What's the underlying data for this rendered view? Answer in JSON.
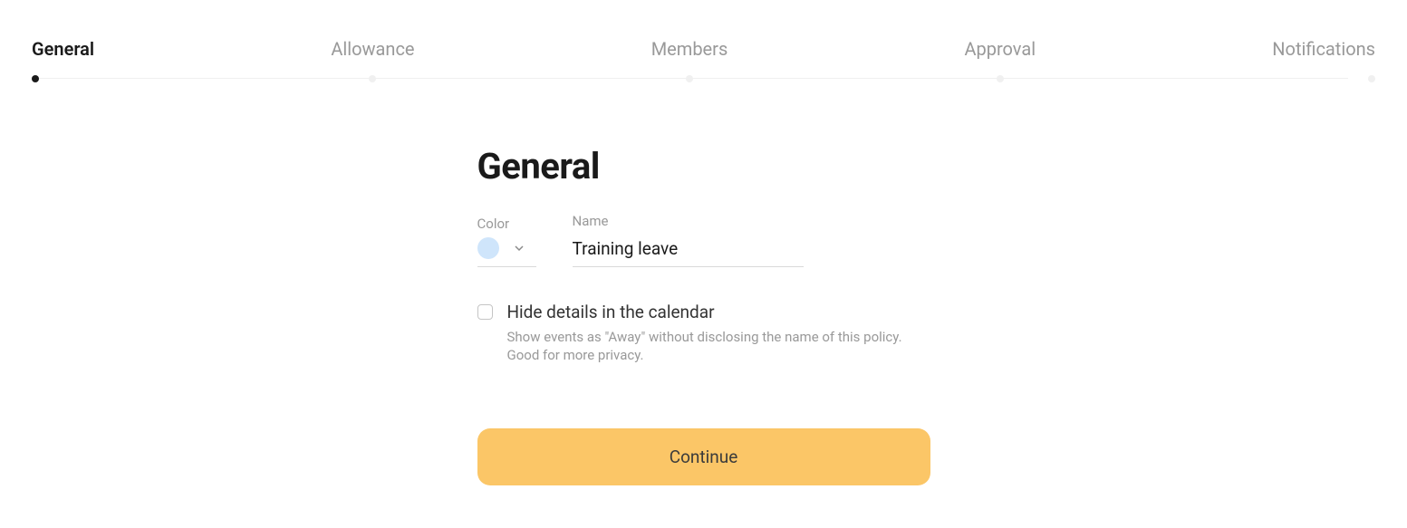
{
  "stepper": {
    "steps": [
      {
        "label": "General",
        "active": true
      },
      {
        "label": "Allowance",
        "active": false
      },
      {
        "label": "Members",
        "active": false
      },
      {
        "label": "Approval",
        "active": false
      },
      {
        "label": "Notifications",
        "active": false
      }
    ]
  },
  "page": {
    "title": "General"
  },
  "form": {
    "color": {
      "label": "Color",
      "value": "#cfe5fb"
    },
    "name": {
      "label": "Name",
      "value": "Training leave"
    },
    "hide_details": {
      "label": "Hide details in the calendar",
      "help": "Show events as \"Away\" without disclosing the name of this policy. Good for more privacy.",
      "checked": false
    },
    "continue_label": "Continue"
  }
}
